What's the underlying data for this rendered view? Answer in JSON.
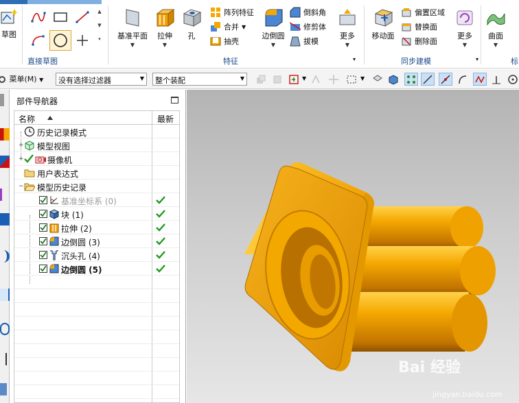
{
  "ribbon": {
    "sketch_label": "草图",
    "direct_sketch_group": "直接草图",
    "feature_group": "特征",
    "sync_group": "同步建模",
    "cut_group_label": "标",
    "datum_plane": "基准平面",
    "extrude": "拉伸",
    "hole": "孔",
    "pattern_feature": "阵列特征",
    "unite": "合并",
    "shell": "抽壳",
    "edge_blend": "边倒圆",
    "chamfer": "倒斜角",
    "trim_body": "修剪体",
    "draft": "拔模",
    "more_feature": "更多",
    "move_face": "移动面",
    "offset_region": "偏置区域",
    "replace_face": "替换面",
    "delete_face": "删除面",
    "more_sync": "更多",
    "surface": "曲面"
  },
  "toolbar": {
    "menu_label": "菜单(M)",
    "filter_value": "没有选择过滤器",
    "assembly_value": "整个装配"
  },
  "navigator": {
    "title": "部件导航器",
    "col_name": "名称",
    "col_latest": "最新",
    "rows": [
      {
        "label": "历史记录模式",
        "bold": false,
        "gray": false
      },
      {
        "label": "模型视图",
        "bold": false,
        "gray": false
      },
      {
        "label": "摄像机",
        "bold": false,
        "gray": false
      },
      {
        "label": "用户表达式",
        "bold": false,
        "gray": false
      },
      {
        "label": "模型历史记录",
        "bold": false,
        "gray": false
      },
      {
        "label": "基准坐标系 (0)",
        "bold": false,
        "gray": true
      },
      {
        "label": "块 (1)",
        "bold": false,
        "gray": false
      },
      {
        "label": "拉伸 (2)",
        "bold": false,
        "gray": false
      },
      {
        "label": "边倒圆 (3)",
        "bold": false,
        "gray": false
      },
      {
        "label": "沉头孔 (4)",
        "bold": false,
        "gray": false
      },
      {
        "label": "边倒圆 (5)",
        "bold": true,
        "gray": false
      }
    ]
  },
  "watermark": {
    "text": "Bai 经验",
    "url": "jingyan.baidu.com"
  },
  "colors": {
    "accent": "#1a4a8a",
    "part": "#f5a800",
    "check": "#1e9a1e"
  }
}
